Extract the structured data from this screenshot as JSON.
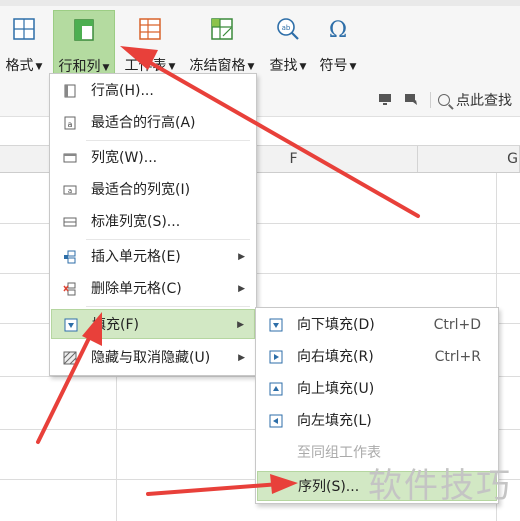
{
  "ribbon": {
    "buttons": [
      {
        "label": "格式",
        "icon": "format-icon"
      },
      {
        "label": "行和列",
        "icon": "rows-columns-icon"
      },
      {
        "label": "工作表",
        "icon": "worksheet-icon"
      },
      {
        "label": "冻结窗格",
        "icon": "freeze-panes-icon"
      },
      {
        "label": "查找",
        "icon": "find-icon"
      },
      {
        "label": "符号",
        "icon": "symbol-icon"
      }
    ],
    "search_label": "点此查找"
  },
  "columns": [
    "F",
    "G"
  ],
  "rows_cols_menu": {
    "items": [
      {
        "label": "行高(H)...",
        "icon": "row-height-icon"
      },
      {
        "label": "最适合的行高(A)",
        "icon": "autofit-row-height-icon"
      },
      {
        "label": "列宽(W)...",
        "icon": "column-width-icon"
      },
      {
        "label": "最适合的列宽(I)",
        "icon": "autofit-column-width-icon"
      },
      {
        "label": "标准列宽(S)...",
        "icon": "standard-column-width-icon"
      },
      {
        "label": "插入单元格(E)",
        "icon": "insert-cells-icon"
      },
      {
        "label": "删除单元格(C)",
        "icon": "delete-cells-icon"
      },
      {
        "label": "填充(F)",
        "icon": "fill-icon"
      },
      {
        "label": "隐藏与取消隐藏(U)",
        "icon": "hide-unhide-icon"
      }
    ]
  },
  "fill_menu": {
    "items": [
      {
        "label": "向下填充(D)",
        "shortcut": "Ctrl+D",
        "icon": "fill-down-icon"
      },
      {
        "label": "向右填充(R)",
        "shortcut": "Ctrl+R",
        "icon": "fill-right-icon"
      },
      {
        "label": "向上填充(U)",
        "shortcut": "",
        "icon": "fill-up-icon"
      },
      {
        "label": "向左填充(L)",
        "shortcut": "",
        "icon": "fill-left-icon"
      },
      {
        "label": "至同组工作表",
        "shortcut": "",
        "icon": ""
      },
      {
        "label": "序列(S)...",
        "shortcut": "",
        "icon": ""
      }
    ]
  },
  "watermark": "软件技巧",
  "colors": {
    "active_button": "#b4dba0",
    "menu_highlight": "#d2e8c4",
    "annotation_arrow": "#e8403a"
  }
}
